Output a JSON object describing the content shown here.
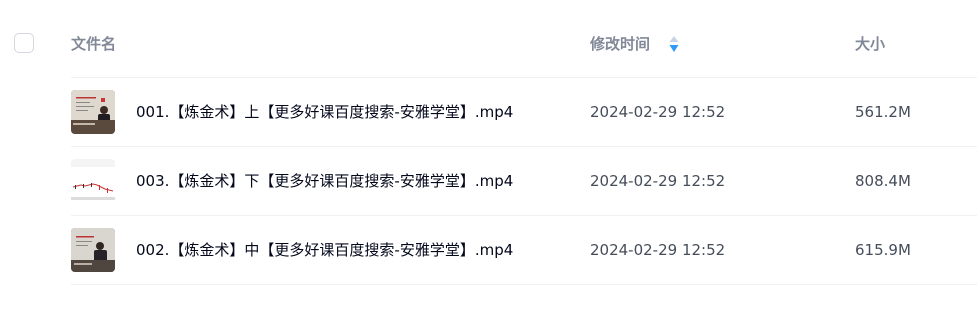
{
  "columns": {
    "name": "文件名",
    "modified": "修改时间",
    "size": "大小"
  },
  "sort": {
    "icon": "sort-icon",
    "color_up": "#c9d3e6",
    "color_down": "#2f9bf8"
  },
  "files": [
    {
      "name": "001.【炼金术】上【更多好课百度搜索-安雅学堂】.mp4",
      "modified": "2024-02-29 12:52",
      "size": "561.2M",
      "thumbnail": "video-thumbnail-lecture"
    },
    {
      "name": "003.【炼金术】下【更多好课百度搜索-安雅学堂】.mp4",
      "modified": "2024-02-29 12:52",
      "size": "808.4M",
      "thumbnail": "video-thumbnail-chart"
    },
    {
      "name": "002.【炼金术】中【更多好课百度搜索-安雅学堂】.mp4",
      "modified": "2024-02-29 12:52",
      "size": "615.9M",
      "thumbnail": "video-thumbnail-lecture"
    }
  ]
}
